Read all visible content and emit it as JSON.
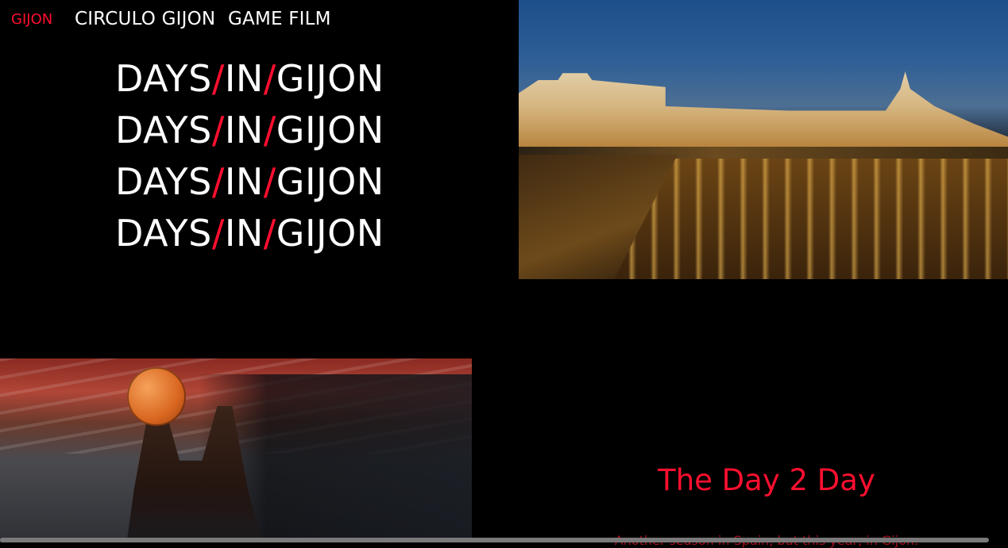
{
  "nav": {
    "brand": "GIJON",
    "links": [
      "CIRCULO GIJON",
      "GAME FILM"
    ]
  },
  "headline": {
    "word1": "DAYS",
    "sep": "/",
    "word2": "IN",
    "word3": "GIJON",
    "repeat_count": 4
  },
  "images": {
    "city": "gijon-night-seafront-photo",
    "player": "basketball-player-shooting-photo"
  },
  "section": {
    "title": "The Day 2 Day",
    "text": "Another season in Spain, but this year, in Gijon."
  },
  "colors": {
    "background": "#000000",
    "accent": "#ff0f2f",
    "text": "#ffffff"
  }
}
